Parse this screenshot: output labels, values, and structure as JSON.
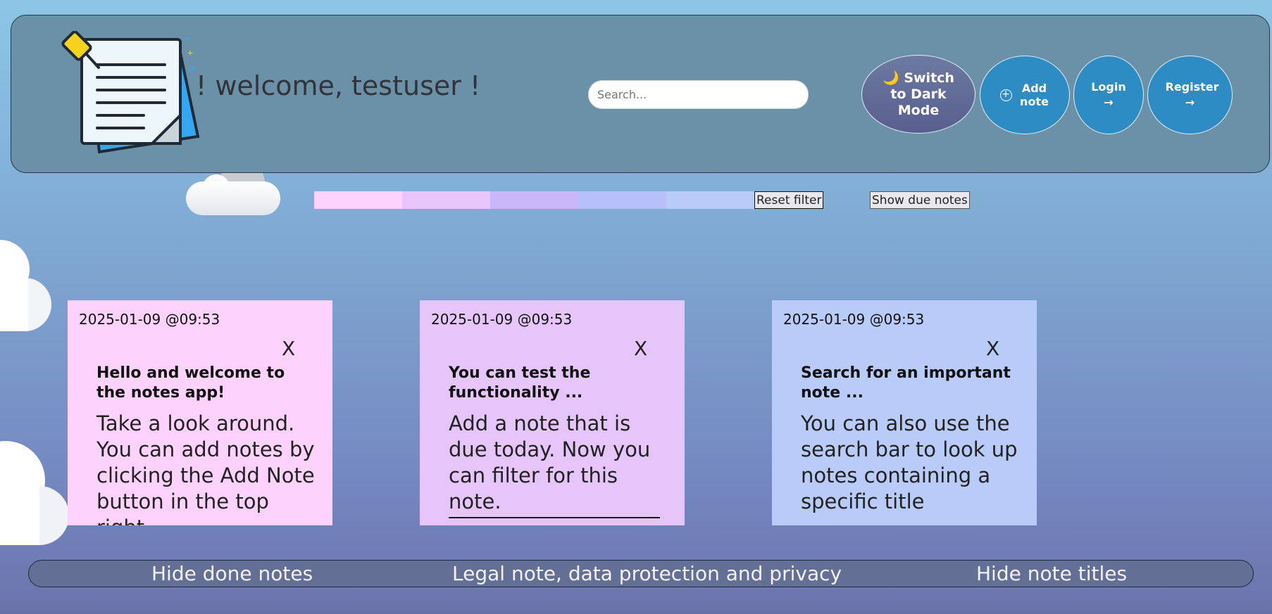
{
  "header": {
    "welcome": "! welcome, testuser !",
    "search_placeholder": "Search...",
    "dark_mode_button": "🌙 Switch to Dark Mode",
    "add_note_button": "Add note",
    "login_button": "Login →",
    "register_button": "Register →"
  },
  "filter": {
    "swatch_colors": [
      "#fdd3fd",
      "#e6c5fb",
      "#c9b8f9",
      "#b7c0fb",
      "#b9cbf9"
    ],
    "reset_label": "Reset filter",
    "due_label": "Show due notes"
  },
  "notes": [
    {
      "timestamp": "2025-01-09 @09:53",
      "close": "X",
      "title": "Hello and welcome to the notes app!",
      "body": "Take a look around. You can add notes by clicking the Add Note button in the top right",
      "color": "#fdd3fd"
    },
    {
      "timestamp": "2025-01-09 @09:53",
      "close": "X",
      "title": "You can test the functionality ...",
      "body": "Add a note that is due today. Now you can filter for this note.",
      "color": "#e6c5fb"
    },
    {
      "timestamp": "2025-01-09 @09:53",
      "close": "X",
      "title": "Search for an important note ...",
      "body": "You can also use the search bar to look up notes containing a specific title",
      "color": "#b9cbf9"
    }
  ],
  "footer": {
    "hide_done": "Hide done notes",
    "legal": "Legal note, data protection and privacy",
    "hide_titles": "Hide note titles"
  }
}
